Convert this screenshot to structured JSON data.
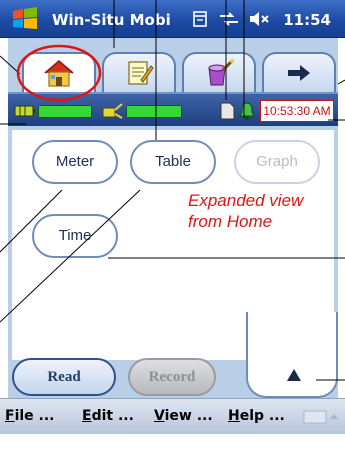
{
  "titlebar": {
    "app_title": "Win-Situ Mobi",
    "time": "11:54",
    "icons": [
      "windows-flag-icon",
      "window-manager-icon",
      "connectivity-icon",
      "speaker-muted-icon"
    ]
  },
  "top_tabs": [
    {
      "id": "home",
      "icon": "home-icon",
      "active": true
    },
    {
      "id": "edit",
      "icon": "edit-notepad-icon",
      "active": false
    },
    {
      "id": "tools",
      "icon": "paint-bucket-icon",
      "active": false
    },
    {
      "id": "next",
      "icon": "arrow-right-icon",
      "active": false
    }
  ],
  "status": {
    "battery_icon": "battery-icon",
    "signal_icon": "probe-icon",
    "doc_icon": "document-icon",
    "bell_icon": "bell-icon",
    "time_display": "10:53:30 AM"
  },
  "views": {
    "meter": "Meter",
    "table": "Table",
    "graph": "Graph",
    "time": "Time"
  },
  "annotation": {
    "line1": "Expanded view",
    "line2": "from Home"
  },
  "buttons": {
    "read": "Read",
    "record": "Record"
  },
  "menu": [
    {
      "key": "F",
      "rest": "ile ..."
    },
    {
      "key": "E",
      "rest": "dit ..."
    },
    {
      "key": "V",
      "rest": "iew ..."
    },
    {
      "key": "H",
      "rest": "elp ..."
    }
  ],
  "colors": {
    "titlebar": "#1d4aa5",
    "app_background": "#b9cfe8",
    "status_green": "#35d935",
    "annotation_red": "#d81717",
    "callout_ring": "#e01414"
  }
}
